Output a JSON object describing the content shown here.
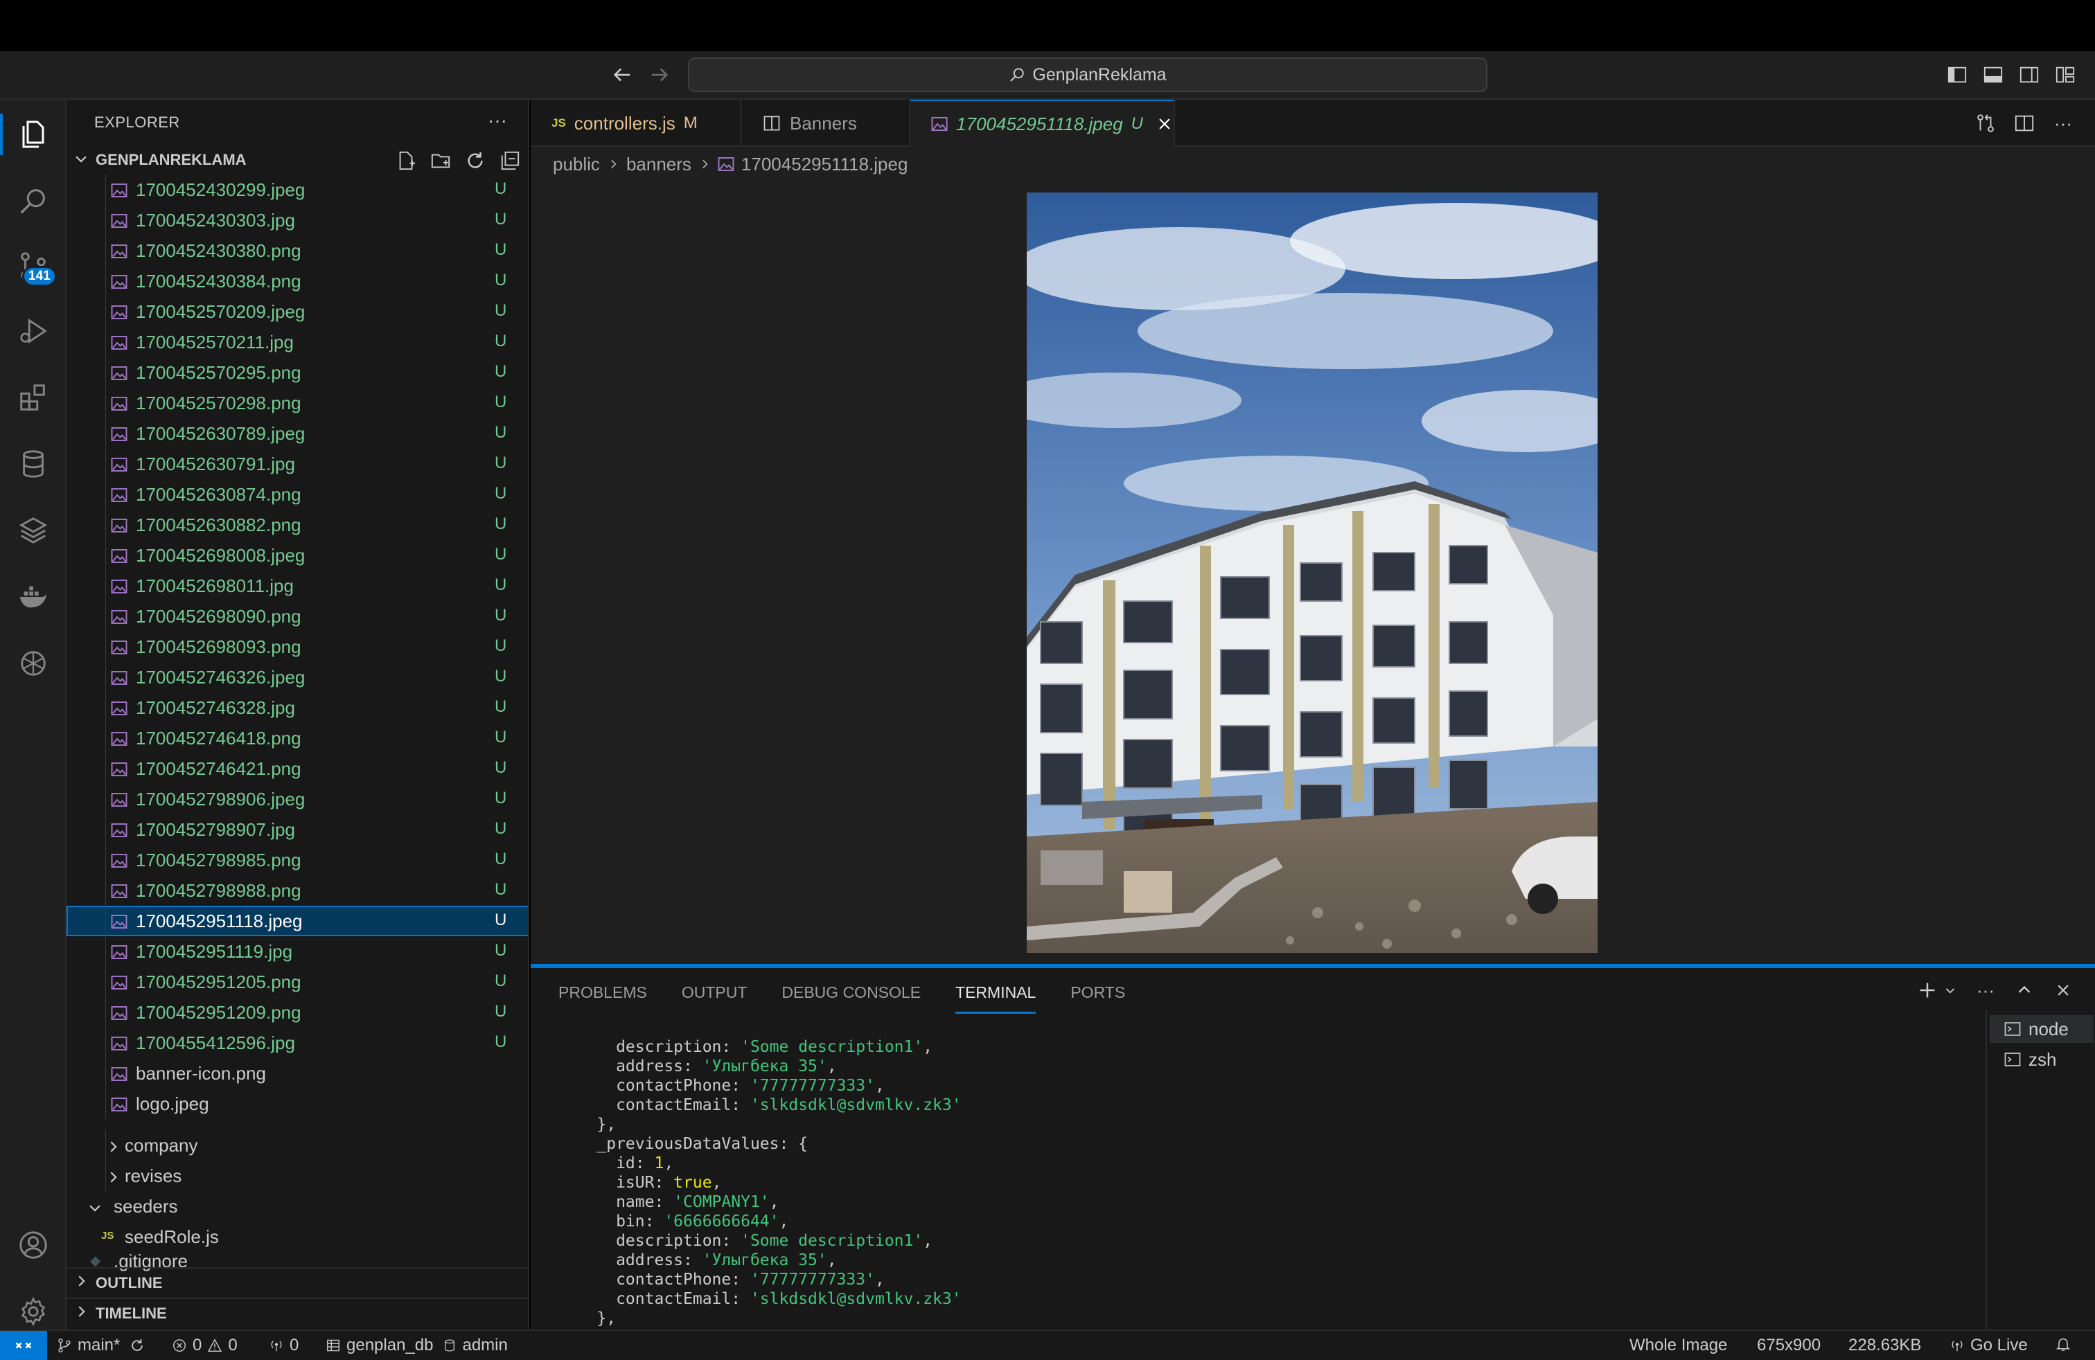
{
  "title_bar": {
    "search_text": "GenplanReklama"
  },
  "activity_bar": {
    "scm_badge": "141"
  },
  "sidebar": {
    "header": "EXPLORER",
    "root": "GENPLANREKLAMA",
    "files": [
      {
        "name": "1700452430299.jpeg",
        "status": "U"
      },
      {
        "name": "1700452430303.jpg",
        "status": "U"
      },
      {
        "name": "1700452430380.png",
        "status": "U"
      },
      {
        "name": "1700452430384.png",
        "status": "U"
      },
      {
        "name": "1700452570209.jpeg",
        "status": "U"
      },
      {
        "name": "1700452570211.jpg",
        "status": "U"
      },
      {
        "name": "1700452570295.png",
        "status": "U"
      },
      {
        "name": "1700452570298.png",
        "status": "U"
      },
      {
        "name": "1700452630789.jpeg",
        "status": "U"
      },
      {
        "name": "1700452630791.jpg",
        "status": "U"
      },
      {
        "name": "1700452630874.png",
        "status": "U"
      },
      {
        "name": "1700452630882.png",
        "status": "U"
      },
      {
        "name": "1700452698008.jpeg",
        "status": "U"
      },
      {
        "name": "1700452698011.jpg",
        "status": "U"
      },
      {
        "name": "1700452698090.png",
        "status": "U"
      },
      {
        "name": "1700452698093.png",
        "status": "U"
      },
      {
        "name": "1700452746326.jpeg",
        "status": "U"
      },
      {
        "name": "1700452746328.jpg",
        "status": "U"
      },
      {
        "name": "1700452746418.png",
        "status": "U"
      },
      {
        "name": "1700452746421.png",
        "status": "U"
      },
      {
        "name": "1700452798906.jpeg",
        "status": "U"
      },
      {
        "name": "1700452798907.jpg",
        "status": "U"
      },
      {
        "name": "1700452798985.png",
        "status": "U"
      },
      {
        "name": "1700452798988.png",
        "status": "U"
      },
      {
        "name": "1700452951118.jpeg",
        "status": "U"
      },
      {
        "name": "1700452951119.jpg",
        "status": "U"
      },
      {
        "name": "1700452951205.png",
        "status": "U"
      },
      {
        "name": "1700452951209.png",
        "status": "U"
      },
      {
        "name": "1700455412596.jpg",
        "status": "U"
      },
      {
        "name": "banner-icon.png",
        "status": ""
      },
      {
        "name": "logo.jpeg",
        "status": ""
      }
    ],
    "folders": {
      "company": "company",
      "revises": "revises",
      "seeders": "seeders",
      "seedrole": "seedRole.js",
      "gitignore": ".gitignore"
    },
    "outline": "OUTLINE",
    "timeline": "TIMELINE"
  },
  "tabs": [
    {
      "label": "controllers.js",
      "modifier": "M"
    },
    {
      "label": "Banners",
      "modifier": ""
    },
    {
      "label": "1700452951118.jpeg",
      "modifier": "U"
    }
  ],
  "breadcrumb": [
    "public",
    "banners",
    "1700452951118.jpeg"
  ],
  "panel": {
    "tabs": [
      "PROBLEMS",
      "OUTPUT",
      "DEBUG CONSOLE",
      "TERMINAL",
      "PORTS"
    ],
    "terminals": [
      "node",
      "zsh"
    ],
    "terminal_lines": [
      [
        {
          "t": "k",
          "v": "      description: "
        },
        {
          "t": "s",
          "v": "'Some description1'"
        },
        {
          "t": "k",
          "v": ","
        }
      ],
      [
        {
          "t": "k",
          "v": "      address: "
        },
        {
          "t": "s",
          "v": "'Улыгбека 35'"
        },
        {
          "t": "k",
          "v": ","
        }
      ],
      [
        {
          "t": "k",
          "v": "      contactPhone: "
        },
        {
          "t": "s",
          "v": "'77777777333'"
        },
        {
          "t": "k",
          "v": ","
        }
      ],
      [
        {
          "t": "k",
          "v": "      contactEmail: "
        },
        {
          "t": "s",
          "v": "'slkdsdkl@sdvmlkv.zk3'"
        }
      ],
      [
        {
          "t": "k",
          "v": "    },"
        }
      ],
      [
        {
          "t": "k",
          "v": "    _previousDataValues: {"
        }
      ],
      [
        {
          "t": "k",
          "v": "      id: "
        },
        {
          "t": "b",
          "v": "1"
        },
        {
          "t": "k",
          "v": ","
        }
      ],
      [
        {
          "t": "k",
          "v": "      isUR: "
        },
        {
          "t": "b",
          "v": "true"
        },
        {
          "t": "k",
          "v": ","
        }
      ],
      [
        {
          "t": "k",
          "v": "      name: "
        },
        {
          "t": "s",
          "v": "'COMPANY1'"
        },
        {
          "t": "k",
          "v": ","
        }
      ],
      [
        {
          "t": "k",
          "v": "      bin: "
        },
        {
          "t": "s",
          "v": "'6666666644'"
        },
        {
          "t": "k",
          "v": ","
        }
      ],
      [
        {
          "t": "k",
          "v": "      description: "
        },
        {
          "t": "s",
          "v": "'Some description1'"
        },
        {
          "t": "k",
          "v": ","
        }
      ],
      [
        {
          "t": "k",
          "v": "      address: "
        },
        {
          "t": "s",
          "v": "'Улыгбека 35'"
        },
        {
          "t": "k",
          "v": ","
        }
      ],
      [
        {
          "t": "k",
          "v": "      contactPhone: "
        },
        {
          "t": "s",
          "v": "'77777777333'"
        },
        {
          "t": "k",
          "v": ","
        }
      ],
      [
        {
          "t": "k",
          "v": "      contactEmail: "
        },
        {
          "t": "s",
          "v": "'slkdsdkl@sdvmlkv.zk3'"
        }
      ],
      [
        {
          "t": "k",
          "v": "    },"
        }
      ]
    ]
  },
  "status_bar": {
    "branch": "main*",
    "errors": "0",
    "warnings": "0",
    "ports": "0",
    "db_name": "genplan_db",
    "db_user": "admin",
    "image_mode": "Whole Image",
    "image_dims": "675x900",
    "image_size": "228.63KB",
    "go_live": "Go Live"
  },
  "colors": {
    "accent": "#0078d4",
    "untracked": "#73c991",
    "modified": "#e2c08d",
    "selection": "#04395e"
  }
}
